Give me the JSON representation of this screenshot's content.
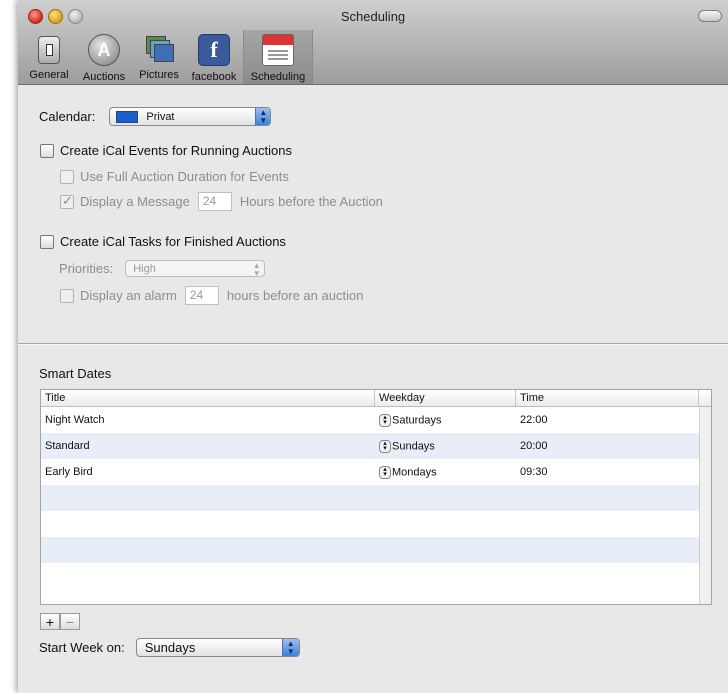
{
  "window": {
    "title": "Scheduling"
  },
  "toolbar": {
    "items": [
      {
        "label": "General",
        "icon": "switch-icon"
      },
      {
        "label": "Auctions",
        "icon": "auction-a-icon",
        "glyph": "A"
      },
      {
        "label": "Pictures",
        "icon": "pictures-icon"
      },
      {
        "label": "facebook",
        "icon": "facebook-icon",
        "glyph": "f"
      },
      {
        "label": "Scheduling",
        "icon": "calendar-icon",
        "selected": true
      }
    ]
  },
  "calendar": {
    "label": "Calendar:",
    "value": "Privat",
    "color": "#1b5ec9"
  },
  "events": {
    "label": "Create iCal Events for Running Auctions",
    "checked": false,
    "full_duration_label": "Use Full Auction Duration for Events",
    "display_message_label": "Display a Message",
    "display_message_checked": true,
    "hours_value": "24",
    "hours_suffix": "Hours before the Auction"
  },
  "tasks": {
    "label": "Create iCal Tasks for Finished Auctions",
    "checked": false,
    "priorities_label": "Priorities:",
    "priorities_value": "High",
    "alarm_label": "Display an alarm",
    "alarm_value": "24",
    "alarm_suffix": "hours before an auction"
  },
  "smart_dates": {
    "heading": "Smart Dates",
    "columns": [
      "Title",
      "Weekday",
      "Time"
    ],
    "rows": [
      {
        "title": "Night Watch",
        "weekday": "Saturdays",
        "time": "22:00"
      },
      {
        "title": "Standard",
        "weekday": "Sundays",
        "time": "20:00"
      },
      {
        "title": "Early Bird",
        "weekday": "Mondays",
        "time": "09:30"
      }
    ],
    "add_label": "+",
    "remove_label": "−"
  },
  "start_week": {
    "label": "Start Week on:",
    "value": "Sundays"
  }
}
